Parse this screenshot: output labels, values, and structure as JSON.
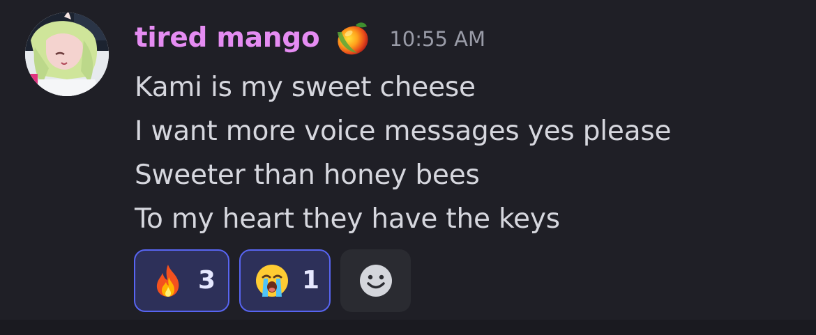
{
  "message": {
    "author": "tired mango",
    "role_icon": "mango-icon",
    "timestamp": "10:55 AM",
    "lines": [
      "Kami is my sweet cheese",
      "I want more voice messages yes please",
      "Sweeter than honey bees",
      "To my heart they have the keys"
    ],
    "reactions": [
      {
        "emoji": "fire-emoji",
        "count": "3",
        "reacted": true
      },
      {
        "emoji": "loudly-crying-face-emoji",
        "count": "1",
        "reacted": true
      }
    ],
    "add_reaction_icon": "smiley-icon"
  },
  "colors": {
    "background": "#1f1f26",
    "username": "#e58cf2",
    "text": "#d6d7de",
    "timestamp": "#9a9ca8",
    "reaction_bg": "#2d3059",
    "reaction_border": "#5865f2"
  }
}
